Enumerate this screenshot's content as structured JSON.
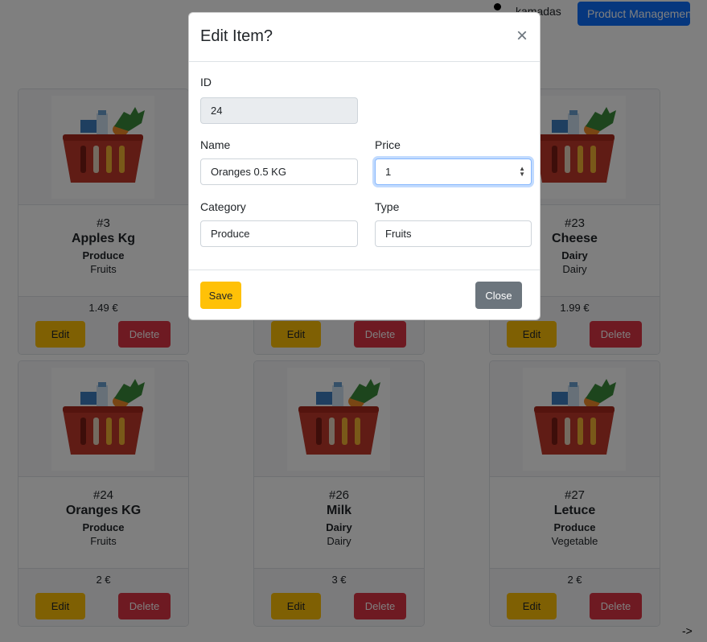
{
  "nav": {
    "user": "kamadas",
    "product_button": "Product Management"
  },
  "products": [
    {
      "id": "#3",
      "name": "Apples Kg",
      "category": "Produce",
      "type": "Fruits",
      "price": "1.49 €"
    },
    {
      "id": "",
      "name": "",
      "category": "",
      "type": "",
      "price": ""
    },
    {
      "id": "#23",
      "name": "Cheese",
      "category": "Dairy",
      "type": "Dairy",
      "price": "1.99 €"
    },
    {
      "id": "#24",
      "name": "Oranges KG",
      "category": "Produce",
      "type": "Fruits",
      "price": "2 €"
    },
    {
      "id": "#26",
      "name": "Milk",
      "category": "Dairy",
      "type": "Dairy",
      "price": "3 €"
    },
    {
      "id": "#27",
      "name": "Letuce",
      "category": "Produce",
      "type": "Vegetable",
      "price": "2 €"
    }
  ],
  "card_buttons": {
    "edit": "Edit",
    "delete": "Delete"
  },
  "modal": {
    "title": "Edit Item?",
    "close_icon": "×",
    "id_label": "ID",
    "id_value": "24",
    "name_label": "Name",
    "name_value": "Oranges 0.5 KG",
    "price_label": "Price",
    "price_value": "1",
    "category_label": "Category",
    "category_value": "Produce",
    "type_label": "Type",
    "type_value": "Fruits",
    "save_button": "Save",
    "close_button": "Close"
  },
  "arrow_text": "->",
  "colors": {
    "primary": "#0d6efd",
    "warning": "#ffc107",
    "danger": "#dc3545",
    "secondary": "#6c757d"
  }
}
